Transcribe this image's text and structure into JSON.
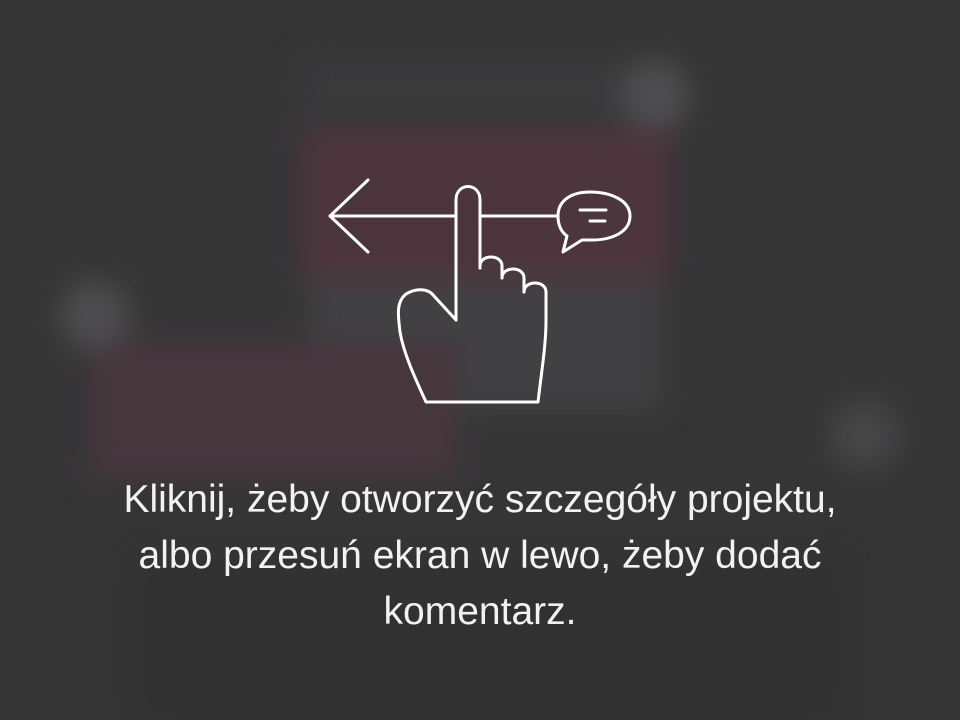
{
  "onboarding": {
    "hint_lines": [
      "Kliknij, żeby otworzyć szczegóły projektu,",
      "albo przesuń ekran w lewo, żeby dodać",
      "komentarz."
    ],
    "icons": {
      "gesture": "swipe-left-hand-icon",
      "arrow": "arrow-left-icon",
      "comment": "comment-bubble-icon"
    }
  },
  "colors": {
    "overlay": "#3a3a3b",
    "icon_stroke": "#ffffff",
    "text": "#f2f2f2"
  }
}
